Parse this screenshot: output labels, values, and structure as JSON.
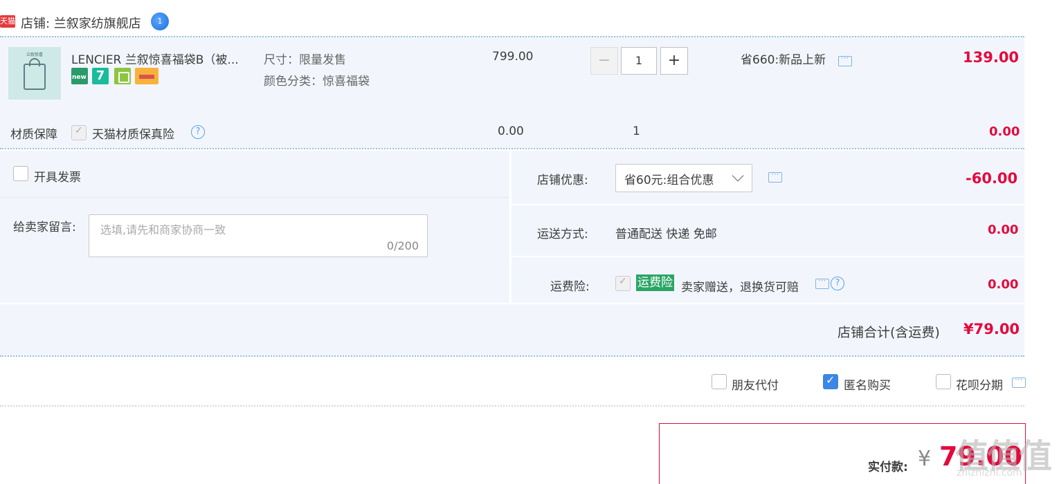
{
  "shop": {
    "badge": "天猫",
    "label": "店铺: 兰叙家纺旗舰店",
    "ww_badge": "1"
  },
  "item": {
    "thumb_brand": "兰叙惊喜",
    "title": "LENCIER 兰叙惊喜福袋B（被...",
    "badge_seven": "7",
    "spec_size": "尺寸：限量发售",
    "spec_color": "颜色分类：惊喜福袋",
    "unit_price": "799.00",
    "qty_minus": "−",
    "qty": "1",
    "qty_plus": "+",
    "promo": "省660:新品上新",
    "subtotal": "139.00"
  },
  "insurance": {
    "label": "材质保障",
    "name": "天猫材质保真险",
    "help": "?",
    "price": "0.00",
    "qty": "1",
    "subtotal": "0.00"
  },
  "invoice": {
    "label": "开具发票"
  },
  "message": {
    "label": "给卖家留言:",
    "placeholder": "选填,请先和商家协商一致",
    "counter": "0/200"
  },
  "shop_discount": {
    "label": "店铺优惠:",
    "selected": "省60元:组合优惠",
    "amount": "-60.00"
  },
  "shipping": {
    "label": "运送方式:",
    "value": "普通配送 快递 免邮",
    "amount": "0.00"
  },
  "freight_insurance": {
    "label": "运费险:",
    "tag": "运费险",
    "text": "卖家赠送，退换货可赔",
    "help": "?",
    "amount": "0.00"
  },
  "shop_total": {
    "label": "店铺合计(含运费)",
    "amount": "¥79.00"
  },
  "options": {
    "friend_pay": "朋友代付",
    "anonymous": "匿名购买",
    "huabei": "花呗分期"
  },
  "payment": {
    "label": "实付款:",
    "currency": "¥",
    "amount": "79.00"
  },
  "watermark": {
    "main": "值值值",
    "sub": "zhizhizhi.com"
  }
}
